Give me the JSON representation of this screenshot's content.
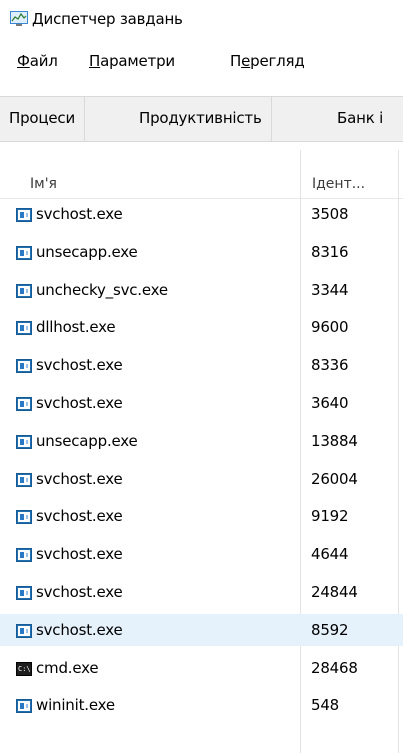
{
  "window": {
    "title": "Диспетчер завдань",
    "icon": "task-manager-icon"
  },
  "menu": [
    {
      "accel": "Ф",
      "rest": "айл"
    },
    {
      "accel": "П",
      "rest": "араметри"
    },
    {
      "pre": "П",
      "accel": "е",
      "rest": "регляд"
    }
  ],
  "tabs": [
    "Процеси",
    "Продуктивність",
    "Банк і"
  ],
  "columns": {
    "name": "Ім'я",
    "pid": "Ідент..."
  },
  "rows": [
    {
      "name": "svchost.exe",
      "pid": "3508",
      "icon": "app-icon"
    },
    {
      "name": "unsecapp.exe",
      "pid": "8316",
      "icon": "app-icon"
    },
    {
      "name": "unchecky_svc.exe",
      "pid": "3344",
      "icon": "app-icon"
    },
    {
      "name": "dllhost.exe",
      "pid": "9600",
      "icon": "app-icon"
    },
    {
      "name": "svchost.exe",
      "pid": "8336",
      "icon": "app-icon"
    },
    {
      "name": "svchost.exe",
      "pid": "3640",
      "icon": "app-icon"
    },
    {
      "name": "unsecapp.exe",
      "pid": "13884",
      "icon": "app-icon"
    },
    {
      "name": "svchost.exe",
      "pid": "26004",
      "icon": "app-icon"
    },
    {
      "name": "svchost.exe",
      "pid": "9192",
      "icon": "app-icon"
    },
    {
      "name": "svchost.exe",
      "pid": "4644",
      "icon": "app-icon"
    },
    {
      "name": "svchost.exe",
      "pid": "24844",
      "icon": "app-icon"
    },
    {
      "name": "svchost.exe",
      "pid": "8592",
      "icon": "app-icon",
      "selected": true
    },
    {
      "name": "cmd.exe",
      "pid": "28468",
      "icon": "cmd-icon"
    },
    {
      "name": "wininit.exe",
      "pid": "548",
      "icon": "app-icon"
    }
  ],
  "colors": {
    "selected_row": "#e5f1fb",
    "tab_bar": "#f0f0f0"
  }
}
